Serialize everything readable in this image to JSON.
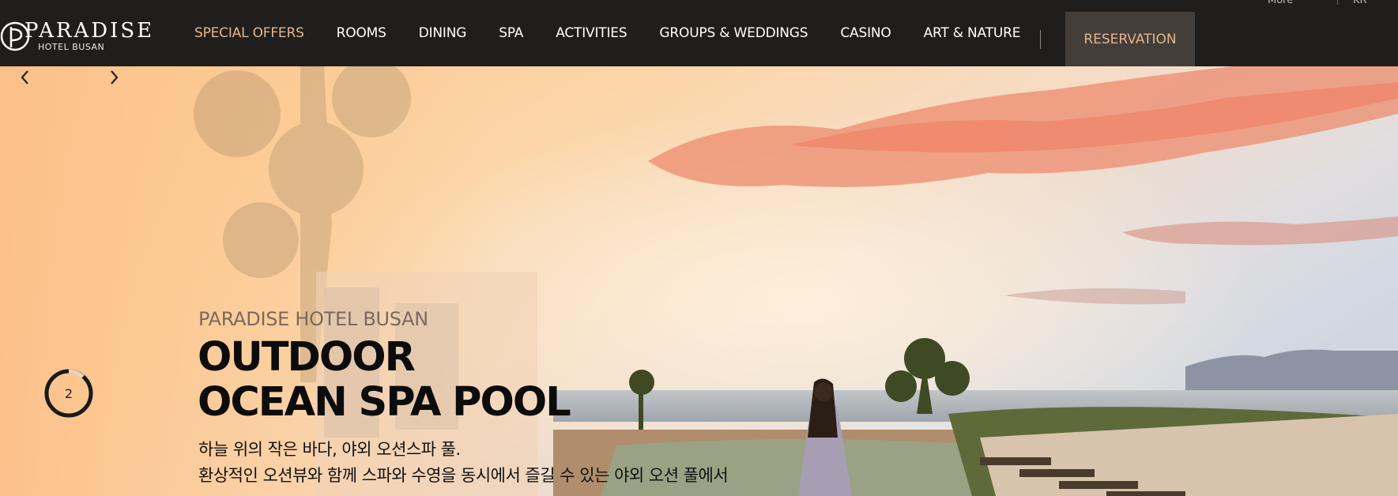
{
  "header": {
    "logo": {
      "word": "PARADISE",
      "sub": "HOTEL BUSAN"
    },
    "nav": [
      {
        "label": "SPECIAL OFFERS",
        "active": true
      },
      {
        "label": "ROOMS"
      },
      {
        "label": "DINING"
      },
      {
        "label": "SPA"
      },
      {
        "label": "ACTIVITIES"
      },
      {
        "label": "GROUPS & WEDDINGS"
      },
      {
        "label": "CASINO"
      },
      {
        "label": "ART & NATURE"
      }
    ],
    "reservation_label": "RESERVATION",
    "util": {
      "more": "More",
      "lang": "KR"
    }
  },
  "hero": {
    "subtitle": "PARADISE HOTEL BUSAN",
    "title_line1": "OUTDOOR",
    "title_line2": "OCEAN SPA POOL",
    "desc_line1": "하늘 위의 작은 바다, 야외 오션스파 풀.",
    "desc_line2": "환상적인 오션뷰와 함께 스파와 수영을 동시에서 즐길 수 있는 야외 오션 풀에서",
    "slider": {
      "current": "2"
    }
  },
  "colors": {
    "accent": "#e4b48c",
    "topbar": "#201e1c",
    "reservation_bg": "#433e3a"
  },
  "icons": {
    "prev": "chevron-left-icon",
    "next": "chevron-right-icon"
  }
}
